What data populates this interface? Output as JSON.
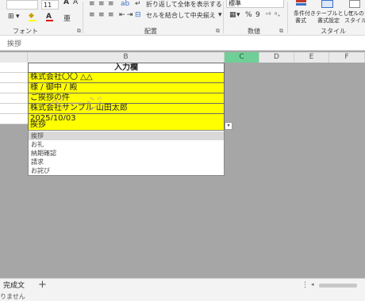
{
  "ribbon": {
    "font_size": "11",
    "wrap_text": "折り返して全体を表示する",
    "merge_center": "セルを結合して中央揃え",
    "number_format": "標準",
    "conditional_format_line1": "条件付き",
    "conditional_format_line2": "書式",
    "format_as_table_line1": "テーブルとして",
    "format_as_table_line2": "書式設定",
    "cell_styles_line1": "セルの",
    "cell_styles_line2": "スタイル",
    "group_font": "フォント",
    "group_alignment": "配置",
    "group_number": "数値",
    "group_styles": "スタイル",
    "percent_symbol": "%",
    "comma_symbol": "9"
  },
  "formula_bar": {
    "value": "挨拶"
  },
  "columns": [
    "B",
    "C",
    "D",
    "E",
    "F"
  ],
  "sheet": {
    "header": "入力欄",
    "rows": [
      "株式会社〇〇 △△",
      "様 / 御中 / 殿",
      "ご挨拶の件",
      "株式会社サンプル 山田太郎",
      "2025/10/03",
      "挨拶"
    ]
  },
  "watermark": "ページ",
  "dropdown": {
    "arrow": "▾",
    "options": [
      "挨拶",
      "お礼",
      "納期確認",
      "請求",
      "お詫び"
    ],
    "selected_index": 0
  },
  "tabs": {
    "sheet_name": "完成文",
    "add": "+",
    "more": "⋮"
  },
  "status": {
    "text": "りません"
  },
  "colors": {
    "input_fill": "#ffff00",
    "selected_column": "#6fcf97",
    "background": "#a6a6a6"
  }
}
